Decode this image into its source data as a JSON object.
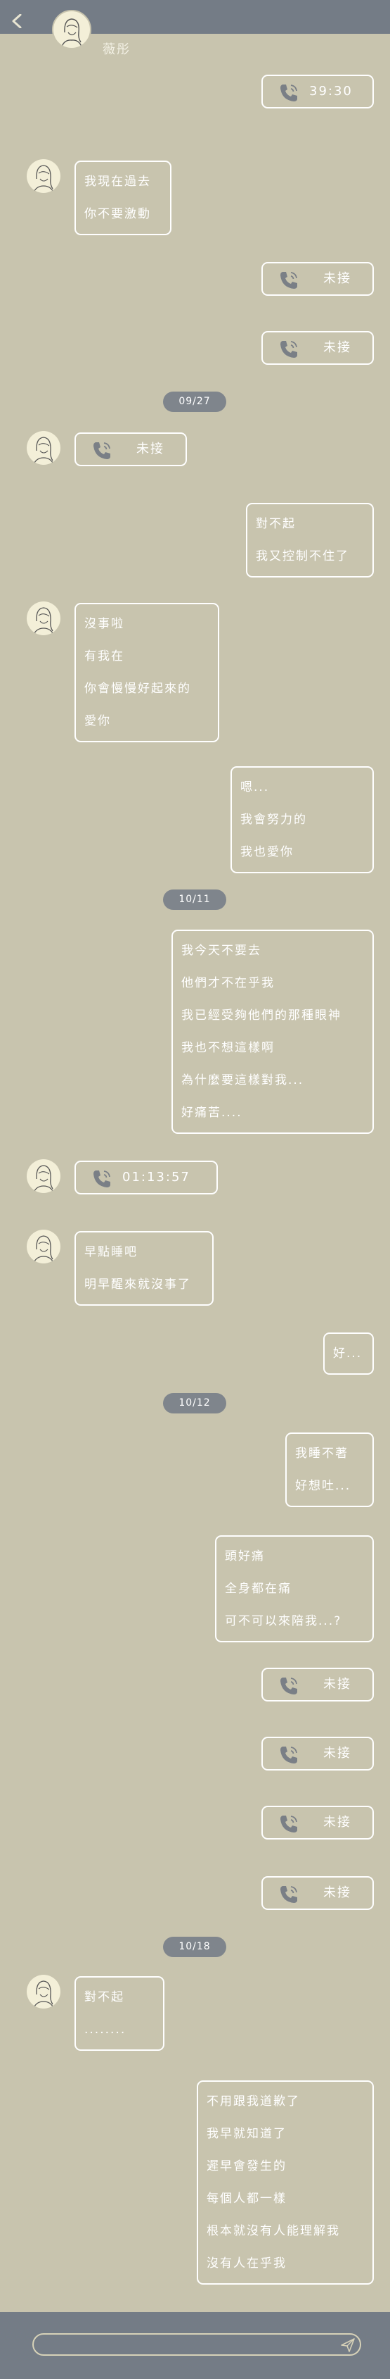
{
  "header": {
    "contact_name": "薇彤",
    "back_icon": "chevron-left-icon"
  },
  "colors": {
    "background": "#c8c4ae",
    "bar": "#747c86",
    "bubble_border": "#ffffff",
    "date_pill": "#7f858c"
  },
  "conversation": [
    {
      "type": "call",
      "side": "right",
      "label": "39:30"
    },
    {
      "type": "text",
      "side": "left",
      "lines": [
        "我現在過去",
        "你不要激動"
      ]
    },
    {
      "type": "call",
      "side": "right",
      "label": "未接"
    },
    {
      "type": "call",
      "side": "right",
      "label": "未接"
    },
    {
      "type": "date",
      "label": "09/27"
    },
    {
      "type": "call",
      "side": "left",
      "label": "未接"
    },
    {
      "type": "text",
      "side": "right",
      "lines": [
        "對不起",
        "我又控制不住了"
      ]
    },
    {
      "type": "text",
      "side": "left",
      "lines": [
        "沒事啦",
        "有我在",
        "你會慢慢好起來的",
        "愛你"
      ]
    },
    {
      "type": "text",
      "side": "right",
      "lines": [
        "嗯...",
        "我會努力的",
        "我也愛你"
      ]
    },
    {
      "type": "date",
      "label": "10/11"
    },
    {
      "type": "text",
      "side": "right",
      "lines": [
        "我今天不要去",
        "他們才不在乎我",
        "我已經受夠他們的那種眼神",
        "我也不想這樣啊",
        "為什麼要這樣對我...",
        "好痛苦...."
      ]
    },
    {
      "type": "call",
      "side": "left",
      "label": "01:13:57"
    },
    {
      "type": "text",
      "side": "left",
      "lines": [
        "早點睡吧",
        "明早醒來就沒事了"
      ]
    },
    {
      "type": "text",
      "side": "right",
      "lines": [
        "好..."
      ]
    },
    {
      "type": "date",
      "label": "10/12"
    },
    {
      "type": "text",
      "side": "right",
      "lines": [
        "我睡不著",
        "好想吐..."
      ]
    },
    {
      "type": "text",
      "side": "right",
      "lines": [
        "頭好痛",
        "全身都在痛",
        "可不可以來陪我...?"
      ]
    },
    {
      "type": "call",
      "side": "right",
      "label": "未接"
    },
    {
      "type": "call",
      "side": "right",
      "label": "未接"
    },
    {
      "type": "call",
      "side": "right",
      "label": "未接"
    },
    {
      "type": "call",
      "side": "right",
      "label": "未接"
    },
    {
      "type": "date",
      "label": "10/18"
    },
    {
      "type": "text",
      "side": "left",
      "lines": [
        "對不起",
        "........"
      ]
    },
    {
      "type": "text",
      "side": "right",
      "lines": [
        "不用跟我道歉了",
        "我早就知道了",
        "遲早會發生的",
        "每個人都一樣",
        "根本就沒有人能理解我",
        "沒有人在乎我"
      ]
    }
  ],
  "footer": {
    "input_value": "",
    "send_icon": "send-icon"
  }
}
